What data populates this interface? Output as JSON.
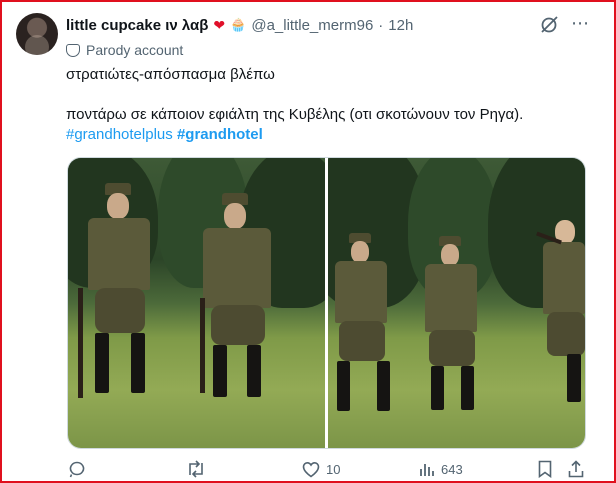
{
  "tweet": {
    "display_name": "little cupcake ιν λαβ",
    "heart_emoji": "❤",
    "cupcake_emoji": "🧁",
    "handle": "@a_little_merm96",
    "separator": "·",
    "time": "12h",
    "parody_label": "Parody account",
    "line1": "στρατιώτες-απόσπασμα βλέπω",
    "line2": "ποντάρω σε κάποιον εφιάλτη της  Κυβέλης (οτι σκοτώνουν τον Ρηγα).",
    "hashtag1": "#grandhotelplus",
    "hashtag2": "#grandhotel"
  },
  "actions": {
    "reply_count": "",
    "retweet_count": "",
    "like_count": "10",
    "views_count": "643"
  },
  "icons": {
    "grok": "grok-icon",
    "more": "more-icon",
    "reply": "reply-icon",
    "retweet": "retweet-icon",
    "like": "heart-icon",
    "views": "views-icon",
    "bookmark": "bookmark-icon",
    "share": "share-icon"
  },
  "colors": {
    "link": "#1d9bf0",
    "muted": "#536471",
    "frame": "#e0101e"
  }
}
